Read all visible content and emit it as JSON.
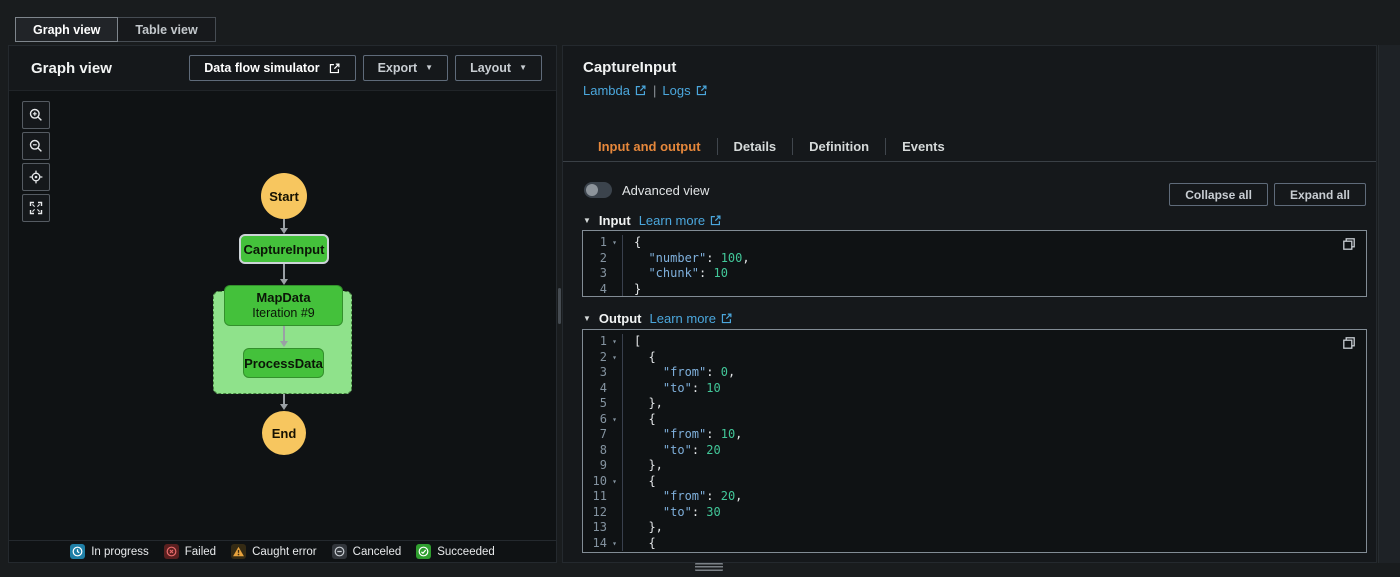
{
  "colors": {
    "accent_orange": "#e5873b",
    "link_blue": "#4ba7dd",
    "node_green": "#44c13b",
    "map_container_green": "#8fe28b",
    "start_end_amber": "#f7c65f",
    "status_in_progress_bg": "#1f7fa6",
    "status_failed_bg": "#5a1f1f",
    "status_failed_glyph": "#e66a6a",
    "status_caught_glyph": "#e8a33d",
    "status_canceled_glyph": "#c6cbd0",
    "status_succeeded_bg": "#2f9e2f",
    "code_key": "#7fb0dc",
    "code_number": "#42c799"
  },
  "view_switcher": {
    "graph_label": "Graph view",
    "table_label": "Table view"
  },
  "left_panel": {
    "title": "Graph view",
    "simulator_button": "Data flow simulator",
    "export_button": "Export",
    "layout_button": "Layout",
    "zoom_controls": [
      "zoom-in",
      "zoom-out",
      "center",
      "fit-to-screen"
    ],
    "graph": {
      "start_label": "Start",
      "capture_label": "CaptureInput",
      "map_label": "MapData",
      "map_iteration": "Iteration #9",
      "process_label": "ProcessData",
      "end_label": "End"
    },
    "legend": [
      {
        "type": "in-progress",
        "label": "In progress"
      },
      {
        "type": "failed",
        "label": "Failed"
      },
      {
        "type": "caught-error",
        "label": "Caught error"
      },
      {
        "type": "canceled",
        "label": "Canceled"
      },
      {
        "type": "succeeded",
        "label": "Succeeded"
      }
    ]
  },
  "right_panel": {
    "title": "CaptureInput",
    "resource_links": {
      "lambda": "Lambda",
      "separator": "|",
      "logs": "Logs"
    },
    "tabs": [
      {
        "label": "Input and output",
        "active": true
      },
      {
        "label": "Details",
        "active": false
      },
      {
        "label": "Definition",
        "active": false
      },
      {
        "label": "Events",
        "active": false
      }
    ],
    "advanced_view_label": "Advanced view",
    "collapse_all_label": "Collapse all",
    "expand_all_label": "Expand all",
    "input_section": {
      "title": "Input",
      "learn_more": "Learn more"
    },
    "output_section": {
      "title": "Output",
      "learn_more": "Learn more"
    },
    "input_code": [
      {
        "n": 1,
        "fold": true,
        "tokens": [
          [
            "p",
            "{"
          ]
        ]
      },
      {
        "n": 2,
        "fold": false,
        "tokens": [
          [
            "p",
            "  "
          ],
          [
            "k",
            "\"number\""
          ],
          [
            "p",
            ": "
          ],
          [
            "n",
            "100"
          ],
          [
            "p",
            ","
          ]
        ]
      },
      {
        "n": 3,
        "fold": false,
        "tokens": [
          [
            "p",
            "  "
          ],
          [
            "k",
            "\"chunk\""
          ],
          [
            "p",
            ": "
          ],
          [
            "n",
            "10"
          ]
        ]
      },
      {
        "n": 4,
        "fold": false,
        "tokens": [
          [
            "p",
            "}"
          ]
        ]
      }
    ],
    "output_code": [
      {
        "n": 1,
        "fold": true,
        "tokens": [
          [
            "p",
            "["
          ]
        ]
      },
      {
        "n": 2,
        "fold": true,
        "tokens": [
          [
            "p",
            "  {"
          ]
        ]
      },
      {
        "n": 3,
        "fold": false,
        "tokens": [
          [
            "p",
            "    "
          ],
          [
            "k",
            "\"from\""
          ],
          [
            "p",
            ": "
          ],
          [
            "n",
            "0"
          ],
          [
            "p",
            ","
          ]
        ]
      },
      {
        "n": 4,
        "fold": false,
        "tokens": [
          [
            "p",
            "    "
          ],
          [
            "k",
            "\"to\""
          ],
          [
            "p",
            ": "
          ],
          [
            "n",
            "10"
          ]
        ]
      },
      {
        "n": 5,
        "fold": false,
        "tokens": [
          [
            "p",
            "  },"
          ]
        ]
      },
      {
        "n": 6,
        "fold": true,
        "tokens": [
          [
            "p",
            "  {"
          ]
        ]
      },
      {
        "n": 7,
        "fold": false,
        "tokens": [
          [
            "p",
            "    "
          ],
          [
            "k",
            "\"from\""
          ],
          [
            "p",
            ": "
          ],
          [
            "n",
            "10"
          ],
          [
            "p",
            ","
          ]
        ]
      },
      {
        "n": 8,
        "fold": false,
        "tokens": [
          [
            "p",
            "    "
          ],
          [
            "k",
            "\"to\""
          ],
          [
            "p",
            ": "
          ],
          [
            "n",
            "20"
          ]
        ]
      },
      {
        "n": 9,
        "fold": false,
        "tokens": [
          [
            "p",
            "  },"
          ]
        ]
      },
      {
        "n": 10,
        "fold": true,
        "tokens": [
          [
            "p",
            "  {"
          ]
        ]
      },
      {
        "n": 11,
        "fold": false,
        "tokens": [
          [
            "p",
            "    "
          ],
          [
            "k",
            "\"from\""
          ],
          [
            "p",
            ": "
          ],
          [
            "n",
            "20"
          ],
          [
            "p",
            ","
          ]
        ]
      },
      {
        "n": 12,
        "fold": false,
        "tokens": [
          [
            "p",
            "    "
          ],
          [
            "k",
            "\"to\""
          ],
          [
            "p",
            ": "
          ],
          [
            "n",
            "30"
          ]
        ]
      },
      {
        "n": 13,
        "fold": false,
        "tokens": [
          [
            "p",
            "  },"
          ]
        ]
      },
      {
        "n": 14,
        "fold": true,
        "tokens": [
          [
            "p",
            "  {"
          ]
        ]
      }
    ]
  }
}
